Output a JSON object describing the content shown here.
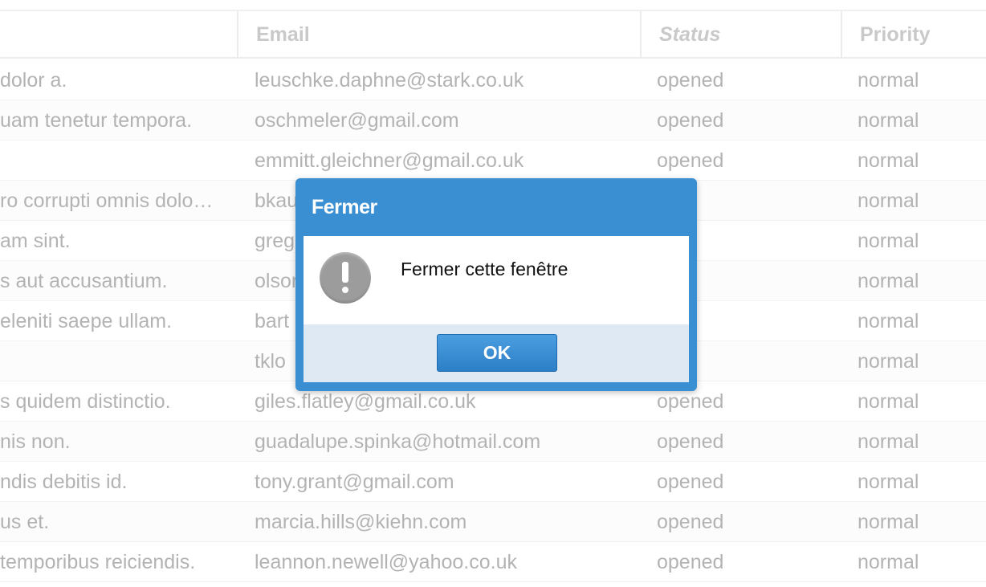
{
  "table": {
    "headers": [
      "",
      "Email",
      "Status",
      "Priority"
    ],
    "rows": [
      {
        "title": "dolor a.",
        "email": "leuschke.daphne@stark.co.uk",
        "status": "opened",
        "priority": "normal"
      },
      {
        "title": "uam tenetur tempora.",
        "email": "oschmeler@gmail.com",
        "status": "opened",
        "priority": "normal"
      },
      {
        "title": "",
        "email": "emmitt.gleichner@gmail.co.uk",
        "status": "opened",
        "priority": "normal"
      },
      {
        "title": "ro corrupti omnis dolo…",
        "email": "bkau",
        "status": "ned",
        "priority": "normal"
      },
      {
        "title": "am sint.",
        "email": "greg",
        "status": "ned",
        "priority": "normal"
      },
      {
        "title": "s aut accusantium.",
        "email": "olsor",
        "status": "ned",
        "priority": "normal"
      },
      {
        "title": "eleniti saepe ullam.",
        "email": "bart",
        "status": "ned",
        "priority": "normal"
      },
      {
        "title": "",
        "email": "tklo",
        "status": "ned",
        "priority": "normal"
      },
      {
        "title": "s quidem distinctio.",
        "email": "giles.flatley@gmail.co.uk",
        "status": "opened",
        "priority": "normal"
      },
      {
        "title": "nis non.",
        "email": "guadalupe.spinka@hotmail.com",
        "status": "opened",
        "priority": "normal"
      },
      {
        "title": "ndis debitis id.",
        "email": "tony.grant@gmail.com",
        "status": "opened",
        "priority": "normal"
      },
      {
        "title": "us et.",
        "email": "marcia.hills@kiehn.com",
        "status": "opened",
        "priority": "normal"
      },
      {
        "title": "temporibus reiciendis.",
        "email": "leannon.newell@yahoo.co.uk",
        "status": "opened",
        "priority": "normal"
      }
    ]
  },
  "dialog": {
    "title": "Fermer",
    "message": "Fermer cette fenêtre",
    "icon": "warning-icon",
    "ok_label": "OK"
  },
  "colors": {
    "dialog_accent": "#3a8fd3",
    "footer_bg": "#dfe9f3",
    "table_text": "#b3b3b3",
    "header_text": "#c9c9c9"
  }
}
